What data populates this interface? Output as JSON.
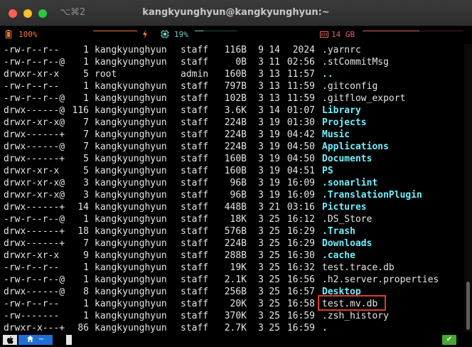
{
  "window": {
    "title": "kangkyunghyun@kangkyunghyun:~",
    "shortcut": "⌥⌘2"
  },
  "status": {
    "battery": "100%",
    "cpu": "19%",
    "memory": "14 GB",
    "colors": {
      "battery": "#f07a3a",
      "cpu": "#6fd0c4",
      "memory": "#e06060"
    }
  },
  "listing": [
    {
      "perm": "-rw-r--r--",
      "links": "1",
      "owner": "kangkyunghyun",
      "group": "staff",
      "size": "116B",
      "month": "9",
      "day": "14",
      "time": "2024",
      "name": ".yarnrc",
      "dir": false
    },
    {
      "perm": "-rw-r--r--@",
      "links": "1",
      "owner": "kangkyunghyun",
      "group": "staff",
      "size": "0B",
      "month": "3",
      "day": "11",
      "time": "02:56",
      "name": ".stCommitMsg",
      "dir": false
    },
    {
      "perm": "drwxr-xr-x",
      "links": "5",
      "owner": "root",
      "group": "admin",
      "size": "160B",
      "month": "3",
      "day": "13",
      "time": "11:57",
      "name": "..",
      "dir": true
    },
    {
      "perm": "-rw-r--r--",
      "links": "1",
      "owner": "kangkyunghyun",
      "group": "staff",
      "size": "797B",
      "month": "3",
      "day": "13",
      "time": "11:59",
      "name": ".gitconfig",
      "dir": false
    },
    {
      "perm": "-rw-r--r--@",
      "links": "1",
      "owner": "kangkyunghyun",
      "group": "staff",
      "size": "102B",
      "month": "3",
      "day": "13",
      "time": "11:59",
      "name": ".gitflow_export",
      "dir": false
    },
    {
      "perm": "drwx------@",
      "links": "116",
      "owner": "kangkyunghyun",
      "group": "staff",
      "size": "3.6K",
      "month": "3",
      "day": "14",
      "time": "01:07",
      "name": "Library",
      "dir": true
    },
    {
      "perm": "drwxr-xr-x@",
      "links": "7",
      "owner": "kangkyunghyun",
      "group": "staff",
      "size": "224B",
      "month": "3",
      "day": "19",
      "time": "01:30",
      "name": "Projects",
      "dir": true
    },
    {
      "perm": "drwx------+",
      "links": "7",
      "owner": "kangkyunghyun",
      "group": "staff",
      "size": "224B",
      "month": "3",
      "day": "19",
      "time": "04:42",
      "name": "Music",
      "dir": true
    },
    {
      "perm": "drwx------@",
      "links": "7",
      "owner": "kangkyunghyun",
      "group": "staff",
      "size": "224B",
      "month": "3",
      "day": "19",
      "time": "04:50",
      "name": "Applications",
      "dir": true
    },
    {
      "perm": "drwx------+",
      "links": "5",
      "owner": "kangkyunghyun",
      "group": "staff",
      "size": "160B",
      "month": "3",
      "day": "19",
      "time": "04:50",
      "name": "Documents",
      "dir": true
    },
    {
      "perm": "drwxr-xr-x",
      "links": "5",
      "owner": "kangkyunghyun",
      "group": "staff",
      "size": "160B",
      "month": "3",
      "day": "19",
      "time": "04:51",
      "name": "PS",
      "dir": true
    },
    {
      "perm": "drwxr-xr-x@",
      "links": "3",
      "owner": "kangkyunghyun",
      "group": "staff",
      "size": "96B",
      "month": "3",
      "day": "19",
      "time": "16:09",
      "name": ".sonarlint",
      "dir": true
    },
    {
      "perm": "drwxr-xr-x@",
      "links": "3",
      "owner": "kangkyunghyun",
      "group": "staff",
      "size": "96B",
      "month": "3",
      "day": "19",
      "time": "16:09",
      "name": ".TranslationPlugin",
      "dir": true
    },
    {
      "perm": "drwx------+",
      "links": "14",
      "owner": "kangkyunghyun",
      "group": "staff",
      "size": "448B",
      "month": "3",
      "day": "21",
      "time": "03:16",
      "name": "Pictures",
      "dir": true
    },
    {
      "perm": "-rw-r--r--@",
      "links": "1",
      "owner": "kangkyunghyun",
      "group": "staff",
      "size": "18K",
      "month": "3",
      "day": "25",
      "time": "16:12",
      "name": ".DS_Store",
      "dir": false
    },
    {
      "perm": "drwx------+",
      "links": "18",
      "owner": "kangkyunghyun",
      "group": "staff",
      "size": "576B",
      "month": "3",
      "day": "25",
      "time": "16:29",
      "name": ".Trash",
      "dir": true
    },
    {
      "perm": "drwx------+",
      "links": "7",
      "owner": "kangkyunghyun",
      "group": "staff",
      "size": "224B",
      "month": "3",
      "day": "25",
      "time": "16:29",
      "name": "Downloads",
      "dir": true
    },
    {
      "perm": "drwxr-xr-x",
      "links": "9",
      "owner": "kangkyunghyun",
      "group": "staff",
      "size": "288B",
      "month": "3",
      "day": "25",
      "time": "16:30",
      "name": ".cache",
      "dir": true
    },
    {
      "perm": "-rw-r--r--",
      "links": "1",
      "owner": "kangkyunghyun",
      "group": "staff",
      "size": "19K",
      "month": "3",
      "day": "25",
      "time": "16:32",
      "name": "test.trace.db",
      "dir": false
    },
    {
      "perm": "-rw-r--r--@",
      "links": "1",
      "owner": "kangkyunghyun",
      "group": "staff",
      "size": "2.1K",
      "month": "3",
      "day": "25",
      "time": "16:56",
      "name": ".h2.server.properties",
      "dir": false
    },
    {
      "perm": "drwx------@",
      "links": "8",
      "owner": "kangkyunghyun",
      "group": "staff",
      "size": "256B",
      "month": "3",
      "day": "25",
      "time": "16:57",
      "name": "Desktop",
      "dir": true
    },
    {
      "perm": "-rw-r--r--",
      "links": "1",
      "owner": "kangkyunghyun",
      "group": "staff",
      "size": "20K",
      "month": "3",
      "day": "25",
      "time": "16:58",
      "name": "test.mv.db",
      "dir": false
    },
    {
      "perm": "-rw-------",
      "links": "1",
      "owner": "kangkyunghyun",
      "group": "staff",
      "size": "370K",
      "month": "3",
      "day": "25",
      "time": "16:59",
      "name": ".zsh_history",
      "dir": false
    },
    {
      "perm": "drwxr-x---+",
      "links": "86",
      "owner": "kangkyunghyun",
      "group": "staff",
      "size": "2.7K",
      "month": "3",
      "day": "25",
      "time": "16:59",
      "name": ".",
      "dir": true
    }
  ],
  "prompt": {
    "apple_icon": "apple-icon",
    "dir_icon": "home-icon",
    "dir": "~",
    "status_icon": "check-icon",
    "status": "✔"
  }
}
